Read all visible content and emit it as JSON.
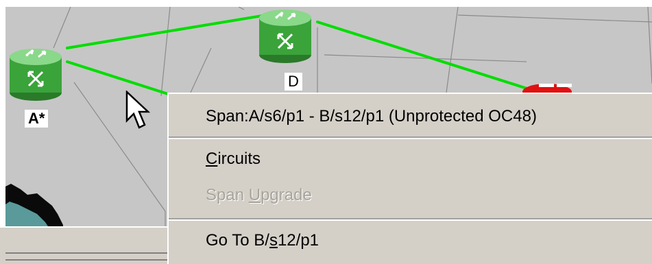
{
  "map": {
    "background_color": "#c6c6c6",
    "link_color": "#00dd00",
    "nodes": [
      {
        "label": "A*",
        "icon": "router-icon",
        "status_color": "#3aa33a"
      },
      {
        "label": "D",
        "icon": "router-icon",
        "status_color": "#3aa33a"
      },
      {
        "label": "",
        "icon": "router-icon",
        "status_color": "#e01010"
      }
    ]
  },
  "context_menu": {
    "title_item": "Span:A/s6/p1 - B/s12/p1 (Unprotected OC48)",
    "circuits": {
      "mnemonic": "C",
      "rest": "ircuits"
    },
    "span_upgrade": {
      "pre": "Span ",
      "mnemonic": "U",
      "post": "pgrade",
      "enabled": false
    },
    "goto": {
      "pre": "Go To B/",
      "mnemonic": "s",
      "post": "12/p1"
    }
  },
  "cursor": {
    "icon": "mouse-pointer-icon"
  }
}
